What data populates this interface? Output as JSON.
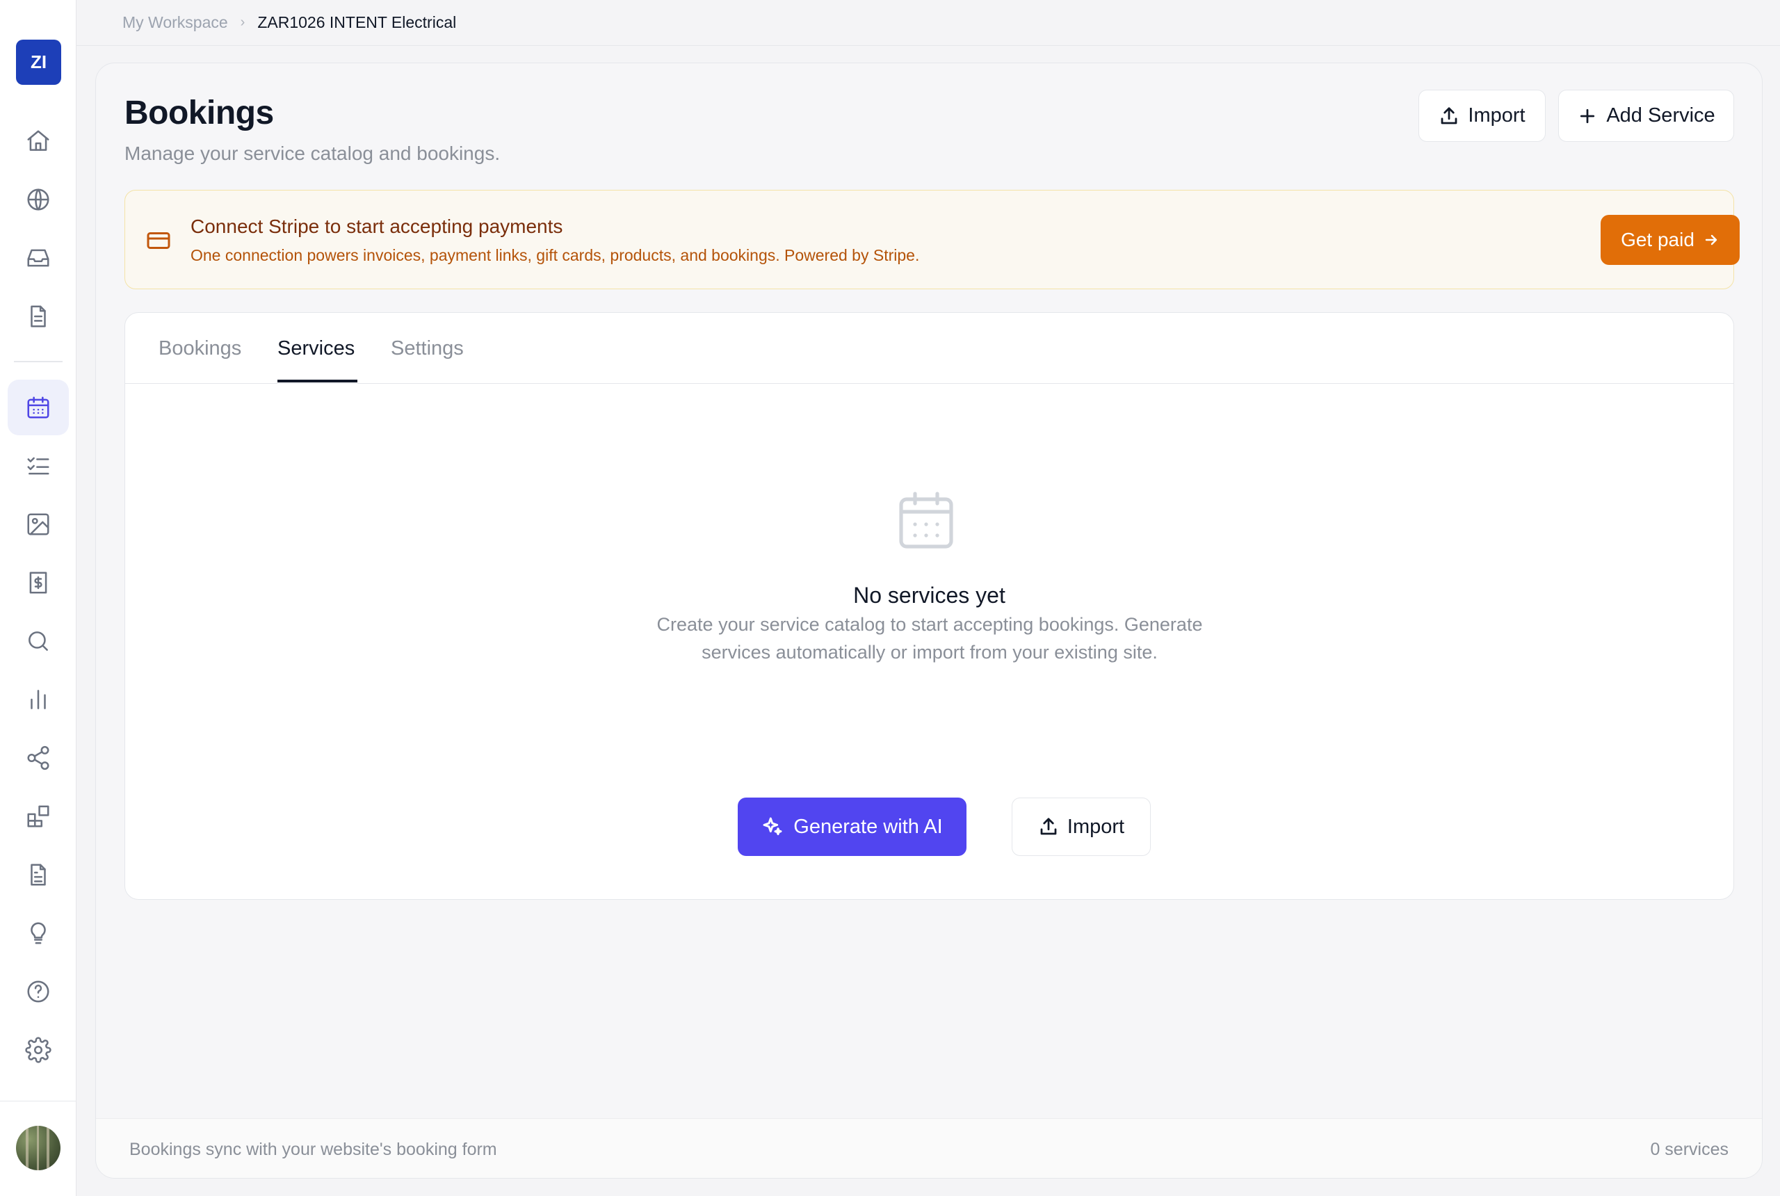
{
  "sidebar": {
    "logo_initials": "ZI",
    "items": [
      {
        "icon": "home-icon"
      },
      {
        "icon": "globe-icon"
      },
      {
        "icon": "inbox-icon"
      },
      {
        "icon": "document-icon"
      },
      {
        "icon": "calendar-icon",
        "active": true
      },
      {
        "icon": "checklist-icon"
      },
      {
        "icon": "image-icon"
      },
      {
        "icon": "receipt-dollar-icon"
      },
      {
        "icon": "search-icon"
      },
      {
        "icon": "bar-chart-icon"
      },
      {
        "icon": "share-icon"
      },
      {
        "icon": "blocks-icon"
      },
      {
        "icon": "file-text-icon"
      },
      {
        "icon": "lightbulb-icon"
      },
      {
        "icon": "help-circle-icon"
      },
      {
        "icon": "settings-gear-icon"
      }
    ],
    "accent_color": "#4f46e5"
  },
  "breadcrumb": {
    "workspace": "My Workspace",
    "current": "ZAR1026 INTENT Electrical"
  },
  "header": {
    "title": "Bookings",
    "subtitle": "Manage your service catalog and bookings.",
    "import_label": "Import",
    "add_service_label": "Add Service"
  },
  "banner": {
    "title": "Connect Stripe to start accepting payments",
    "description": "One connection powers invoices, payment links, gift cards, products, and bookings. Powered by Stripe.",
    "cta_label": "Get paid",
    "cta_color": "#e16e08"
  },
  "tabs": [
    {
      "label": "Bookings",
      "active": false
    },
    {
      "label": "Services",
      "active": true
    },
    {
      "label": "Settings",
      "active": false
    }
  ],
  "empty_state": {
    "icon": "calendar-icon",
    "title": "No services yet",
    "description": "Create your service catalog to start accepting bookings. Generate services automatically or import from your existing site.",
    "generate_label": "Generate with AI",
    "generate_color": "#5145f0",
    "import_label": "Import"
  },
  "footer": {
    "note": "Bookings sync with your website's booking form",
    "count": "0 services"
  }
}
